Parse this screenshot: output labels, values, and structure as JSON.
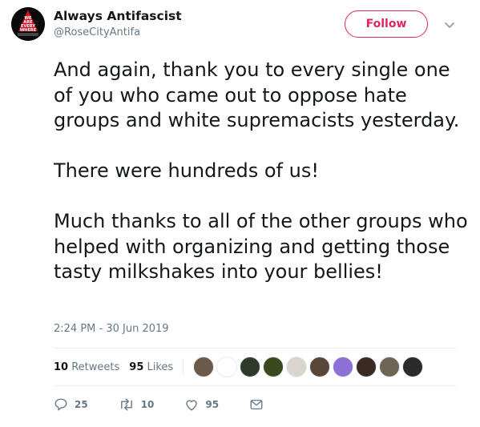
{
  "author": {
    "display_name": "Always Antifascist",
    "handle": "@RoseCityAntifa",
    "avatar_text": "WE ARE EVERY WHERE"
  },
  "follow_label": "Follow",
  "tweet": {
    "paragraphs": [
      "And again, thank you to every single one of you who came out to oppose hate groups and white supremacists yesterday.",
      "There were hundreds of us!",
      "Much thanks to all of the other groups who helped with organizing and getting those tasty milkshakes into your bellies!"
    ],
    "timestamp": "2:24 PM - 30 Jun 2019"
  },
  "stats": {
    "retweets_count": "10",
    "retweets_label": "Retweets",
    "likes_count": "95",
    "likes_label": "Likes"
  },
  "likers": [
    "#6b5a4a",
    "#ffffff",
    "#2f3b2a",
    "#3a4a1e",
    "#d9d4cc",
    "#5a4638",
    "#8e6fd8",
    "#3b2a22",
    "#6d6454",
    "#2b2b2b"
  ],
  "actions": {
    "reply_count": "25",
    "retweet_count": "10",
    "like_count": "95"
  },
  "colors": {
    "accent": "#e0245e",
    "secondary_text": "#657786",
    "divider": "#e6ecf0"
  },
  "icons": [
    "chevron-down-icon",
    "reply-icon",
    "retweet-icon",
    "like-icon",
    "message-icon"
  ]
}
